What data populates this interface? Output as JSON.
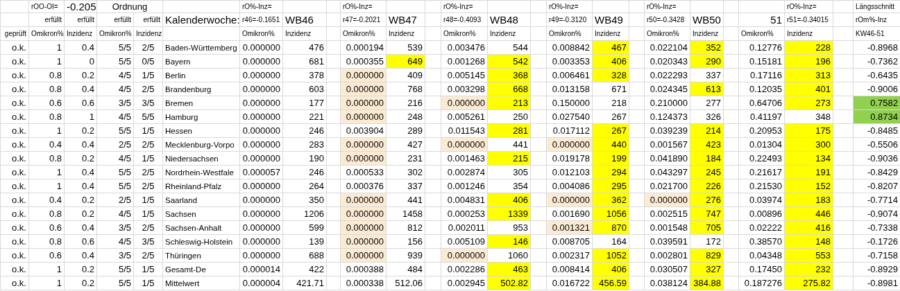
{
  "header": {
    "corr_label": "rOO-OI=",
    "corr_value": "-0.205",
    "order_label": "Ordnung",
    "fulfilled": [
      "erfüllt",
      "erfüllt",
      "erfüllt",
      "erfüllt"
    ],
    "week_label": "Kalenderwoche:",
    "columns": [
      "geprüft",
      "Omikron%",
      "Inzidenz",
      "Omikron%",
      "Inzidenz"
    ]
  },
  "weeks": [
    {
      "kind": "standard",
      "corr_label": "rO%-Inz=",
      "corr": "r46=-0.1651",
      "name": "WB46",
      "columns": [
        "Omikron%",
        "Inzidenz"
      ]
    },
    {
      "kind": "standard",
      "corr_label": "rO%-Inz=",
      "corr": "r47=-0.2021",
      "name": "WB47",
      "columns": [
        "Omikron%",
        "Inzidenz"
      ]
    },
    {
      "kind": "standard",
      "corr_label": "rO%-Inz=",
      "corr": "r48=-0.4093",
      "name": "WB48",
      "columns": [
        "Omikron%",
        "Inzidenz"
      ]
    },
    {
      "kind": "standard",
      "corr_label": "rO%-Inz=",
      "corr": "r49=-0.3120",
      "name": "WB49",
      "columns": [
        "Omikron%",
        "Inzidenz"
      ]
    },
    {
      "kind": "standard",
      "corr_label": "rO%-Inz=",
      "corr": "r50=-0.3428",
      "name": "WB50",
      "columns": [
        "Omikron%",
        "Inzidenz"
      ]
    },
    {
      "kind": "shifted",
      "corr_label": "rO%-Inz=",
      "corr": "r51=-0.34015",
      "name": "51",
      "columns": [
        "Omikron%",
        "Inzidenz"
      ]
    }
  ],
  "summary": {
    "title": "Längsschnitt",
    "subtitle": "rOm%-Inz",
    "range": "KW46-51"
  },
  "rows": [
    {
      "check": "o.k.",
      "omikron": "1",
      "inzidenz": "0.4",
      "order_omikron": "5/5",
      "order_inzidenz": "2/5",
      "state": "Baden-Württemberg",
      "weeks": [
        {
          "omikron": "0.000000",
          "inzidenz": "476",
          "omikron_low": false,
          "inzidenz_high": false
        },
        {
          "omikron": "0.000194",
          "inzidenz": "539",
          "omikron_low": false,
          "inzidenz_high": false
        },
        {
          "omikron": "0.003476",
          "inzidenz": "544",
          "omikron_low": false,
          "inzidenz_high": false
        },
        {
          "omikron": "0.008842",
          "inzidenz": "467",
          "omikron_low": false,
          "inzidenz_high": true
        },
        {
          "omikron": "0.022104",
          "inzidenz": "352",
          "omikron_low": false,
          "inzidenz_high": true
        },
        {
          "omikron": "0.12776",
          "inzidenz": "228",
          "omikron_low": false,
          "inzidenz_high": true
        }
      ],
      "correlation": "-0.8968",
      "positive": false
    },
    {
      "check": "o.k.",
      "omikron": "1",
      "inzidenz": "0",
      "order_omikron": "5/5",
      "order_inzidenz": "0/5",
      "state": "Bayern",
      "weeks": [
        {
          "omikron": "0.000000",
          "inzidenz": "681",
          "omikron_low": false,
          "inzidenz_high": false
        },
        {
          "omikron": "0.000355",
          "inzidenz": "649",
          "omikron_low": false,
          "inzidenz_high": true
        },
        {
          "omikron": "0.001268",
          "inzidenz": "542",
          "omikron_low": false,
          "inzidenz_high": true
        },
        {
          "omikron": "0.003353",
          "inzidenz": "406",
          "omikron_low": false,
          "inzidenz_high": true
        },
        {
          "omikron": "0.020343",
          "inzidenz": "290",
          "omikron_low": false,
          "inzidenz_high": true
        },
        {
          "omikron": "0.15181",
          "inzidenz": "196",
          "omikron_low": false,
          "inzidenz_high": true
        }
      ],
      "correlation": "-0.7362",
      "positive": false
    },
    {
      "check": "o.k.",
      "omikron": "0.8",
      "inzidenz": "0.2",
      "order_omikron": "4/5",
      "order_inzidenz": "1/5",
      "state": "Berlin",
      "weeks": [
        {
          "omikron": "0.000000",
          "inzidenz": "378",
          "omikron_low": false,
          "inzidenz_high": false
        },
        {
          "omikron": "0.000000",
          "inzidenz": "409",
          "omikron_low": true,
          "inzidenz_high": false
        },
        {
          "omikron": "0.005145",
          "inzidenz": "368",
          "omikron_low": false,
          "inzidenz_high": true
        },
        {
          "omikron": "0.006461",
          "inzidenz": "328",
          "omikron_low": false,
          "inzidenz_high": true
        },
        {
          "omikron": "0.022293",
          "inzidenz": "337",
          "omikron_low": false,
          "inzidenz_high": false
        },
        {
          "omikron": "0.17116",
          "inzidenz": "313",
          "omikron_low": false,
          "inzidenz_high": true
        }
      ],
      "correlation": "-0.6435",
      "positive": false
    },
    {
      "check": "o.k.",
      "omikron": "0.8",
      "inzidenz": "0.4",
      "order_omikron": "4/5",
      "order_inzidenz": "2/5",
      "state": "Brandenburg",
      "weeks": [
        {
          "omikron": "0.000000",
          "inzidenz": "603",
          "omikron_low": false,
          "inzidenz_high": false
        },
        {
          "omikron": "0.000000",
          "inzidenz": "768",
          "omikron_low": true,
          "inzidenz_high": false
        },
        {
          "omikron": "0.003298",
          "inzidenz": "668",
          "omikron_low": false,
          "inzidenz_high": true
        },
        {
          "omikron": "0.013158",
          "inzidenz": "671",
          "omikron_low": false,
          "inzidenz_high": false
        },
        {
          "omikron": "0.024345",
          "inzidenz": "613",
          "omikron_low": false,
          "inzidenz_high": true
        },
        {
          "omikron": "0.12035",
          "inzidenz": "401",
          "omikron_low": false,
          "inzidenz_high": true
        }
      ],
      "correlation": "-0.9006",
      "positive": false
    },
    {
      "check": "o.k.",
      "omikron": "0.6",
      "inzidenz": "0.6",
      "order_omikron": "3/5",
      "order_inzidenz": "3/5",
      "state": "Bremen",
      "weeks": [
        {
          "omikron": "0.000000",
          "inzidenz": "177",
          "omikron_low": false,
          "inzidenz_high": false
        },
        {
          "omikron": "0.000000",
          "inzidenz": "216",
          "omikron_low": true,
          "inzidenz_high": false
        },
        {
          "omikron": "0.000000",
          "inzidenz": "213",
          "omikron_low": true,
          "inzidenz_high": true
        },
        {
          "omikron": "0.150000",
          "inzidenz": "218",
          "omikron_low": false,
          "inzidenz_high": false
        },
        {
          "omikron": "0.210000",
          "inzidenz": "277",
          "omikron_low": false,
          "inzidenz_high": false
        },
        {
          "omikron": "0.64706",
          "inzidenz": "273",
          "omikron_low": false,
          "inzidenz_high": true
        }
      ],
      "correlation": "0.7582",
      "positive": true
    },
    {
      "check": "o.k.",
      "omikron": "0.8",
      "inzidenz": "1",
      "order_omikron": "4/5",
      "order_inzidenz": "5/5",
      "state": "Hamburg",
      "weeks": [
        {
          "omikron": "0.000000",
          "inzidenz": "221",
          "omikron_low": false,
          "inzidenz_high": false
        },
        {
          "omikron": "0.000000",
          "inzidenz": "248",
          "omikron_low": true,
          "inzidenz_high": false
        },
        {
          "omikron": "0.005261",
          "inzidenz": "250",
          "omikron_low": false,
          "inzidenz_high": false
        },
        {
          "omikron": "0.027540",
          "inzidenz": "267",
          "omikron_low": false,
          "inzidenz_high": false
        },
        {
          "omikron": "0.124373",
          "inzidenz": "326",
          "omikron_low": false,
          "inzidenz_high": false
        },
        {
          "omikron": "0.41197",
          "inzidenz": "348",
          "omikron_low": false,
          "inzidenz_high": false
        }
      ],
      "correlation": "0.8734",
      "positive": true
    },
    {
      "check": "o.k.",
      "omikron": "1",
      "inzidenz": "0.2",
      "order_omikron": "5/5",
      "order_inzidenz": "1/5",
      "state": "Hessen",
      "weeks": [
        {
          "omikron": "0.000000",
          "inzidenz": "246",
          "omikron_low": false,
          "inzidenz_high": false
        },
        {
          "omikron": "0.003904",
          "inzidenz": "289",
          "omikron_low": false,
          "inzidenz_high": false
        },
        {
          "omikron": "0.011543",
          "inzidenz": "281",
          "omikron_low": false,
          "inzidenz_high": true
        },
        {
          "omikron": "0.017112",
          "inzidenz": "267",
          "omikron_low": false,
          "inzidenz_high": true
        },
        {
          "omikron": "0.039239",
          "inzidenz": "214",
          "omikron_low": false,
          "inzidenz_high": true
        },
        {
          "omikron": "0.20953",
          "inzidenz": "175",
          "omikron_low": false,
          "inzidenz_high": true
        }
      ],
      "correlation": "-0.8485",
      "positive": false
    },
    {
      "check": "o.k.",
      "omikron": "0.4",
      "inzidenz": "0.4",
      "order_omikron": "2/5",
      "order_inzidenz": "2/5",
      "state": "Mecklenburg-Vorpo",
      "weeks": [
        {
          "omikron": "0.000000",
          "inzidenz": "283",
          "omikron_low": false,
          "inzidenz_high": false
        },
        {
          "omikron": "0.000000",
          "inzidenz": "427",
          "omikron_low": true,
          "inzidenz_high": false
        },
        {
          "omikron": "0.000000",
          "inzidenz": "441",
          "omikron_low": true,
          "inzidenz_high": false
        },
        {
          "omikron": "0.000000",
          "inzidenz": "440",
          "omikron_low": true,
          "inzidenz_high": true
        },
        {
          "omikron": "0.001567",
          "inzidenz": "423",
          "omikron_low": false,
          "inzidenz_high": true
        },
        {
          "omikron": "0.01304",
          "inzidenz": "300",
          "omikron_low": false,
          "inzidenz_high": true
        }
      ],
      "correlation": "-0.5506",
      "positive": false
    },
    {
      "check": "o.k.",
      "omikron": "0.8",
      "inzidenz": "0.2",
      "order_omikron": "4/5",
      "order_inzidenz": "1/5",
      "state": "Niedersachsen",
      "weeks": [
        {
          "omikron": "0.000000",
          "inzidenz": "190",
          "omikron_low": false,
          "inzidenz_high": false
        },
        {
          "omikron": "0.000000",
          "inzidenz": "231",
          "omikron_low": true,
          "inzidenz_high": false
        },
        {
          "omikron": "0.001463",
          "inzidenz": "215",
          "omikron_low": false,
          "inzidenz_high": true
        },
        {
          "omikron": "0.019178",
          "inzidenz": "199",
          "omikron_low": false,
          "inzidenz_high": true
        },
        {
          "omikron": "0.041890",
          "inzidenz": "184",
          "omikron_low": false,
          "inzidenz_high": true
        },
        {
          "omikron": "0.22493",
          "inzidenz": "134",
          "omikron_low": false,
          "inzidenz_high": true
        }
      ],
      "correlation": "-0.9036",
      "positive": false
    },
    {
      "check": "o.k.",
      "omikron": "1",
      "inzidenz": "0.4",
      "order_omikron": "5/5",
      "order_inzidenz": "2/5",
      "state": "Nordrhein-Westfale",
      "weeks": [
        {
          "omikron": "0.000057",
          "inzidenz": "246",
          "omikron_low": false,
          "inzidenz_high": false
        },
        {
          "omikron": "0.000533",
          "inzidenz": "302",
          "omikron_low": false,
          "inzidenz_high": false
        },
        {
          "omikron": "0.002874",
          "inzidenz": "305",
          "omikron_low": false,
          "inzidenz_high": false
        },
        {
          "omikron": "0.012103",
          "inzidenz": "294",
          "omikron_low": false,
          "inzidenz_high": true
        },
        {
          "omikron": "0.043297",
          "inzidenz": "245",
          "omikron_low": false,
          "inzidenz_high": true
        },
        {
          "omikron": "0.21617",
          "inzidenz": "191",
          "omikron_low": false,
          "inzidenz_high": true
        }
      ],
      "correlation": "-0.8429",
      "positive": false
    },
    {
      "check": "o.k.",
      "omikron": "1",
      "inzidenz": "0.4",
      "order_omikron": "5/5",
      "order_inzidenz": "2/5",
      "state": "Rheinland-Pfalz",
      "weeks": [
        {
          "omikron": "0.000000",
          "inzidenz": "264",
          "omikron_low": false,
          "inzidenz_high": false
        },
        {
          "omikron": "0.000376",
          "inzidenz": "337",
          "omikron_low": false,
          "inzidenz_high": false
        },
        {
          "omikron": "0.001246",
          "inzidenz": "354",
          "omikron_low": false,
          "inzidenz_high": false
        },
        {
          "omikron": "0.004086",
          "inzidenz": "295",
          "omikron_low": false,
          "inzidenz_high": true
        },
        {
          "omikron": "0.021700",
          "inzidenz": "226",
          "omikron_low": false,
          "inzidenz_high": true
        },
        {
          "omikron": "0.21530",
          "inzidenz": "152",
          "omikron_low": false,
          "inzidenz_high": true
        }
      ],
      "correlation": "-0.8207",
      "positive": false
    },
    {
      "check": "o.k.",
      "omikron": "0.4",
      "inzidenz": "0.2",
      "order_omikron": "2/5",
      "order_inzidenz": "1/5",
      "state": "Saarland",
      "weeks": [
        {
          "omikron": "0.000000",
          "inzidenz": "350",
          "omikron_low": false,
          "inzidenz_high": false
        },
        {
          "omikron": "0.000000",
          "inzidenz": "441",
          "omikron_low": true,
          "inzidenz_high": false
        },
        {
          "omikron": "0.004831",
          "inzidenz": "406",
          "omikron_low": false,
          "inzidenz_high": true
        },
        {
          "omikron": "0.000000",
          "inzidenz": "362",
          "omikron_low": true,
          "inzidenz_high": true
        },
        {
          "omikron": "0.000000",
          "inzidenz": "276",
          "omikron_low": true,
          "inzidenz_high": true
        },
        {
          "omikron": "0.03974",
          "inzidenz": "183",
          "omikron_low": false,
          "inzidenz_high": true
        }
      ],
      "correlation": "-0.7714",
      "positive": false
    },
    {
      "check": "o.k.",
      "omikron": "0.8",
      "inzidenz": "0.2",
      "order_omikron": "4/5",
      "order_inzidenz": "1/5",
      "state": "Sachsen",
      "weeks": [
        {
          "omikron": "0.000000",
          "inzidenz": "1206",
          "omikron_low": false,
          "inzidenz_high": false
        },
        {
          "omikron": "0.000000",
          "inzidenz": "1458",
          "omikron_low": true,
          "inzidenz_high": false
        },
        {
          "omikron": "0.000253",
          "inzidenz": "1339",
          "omikron_low": false,
          "inzidenz_high": true
        },
        {
          "omikron": "0.001690",
          "inzidenz": "1056",
          "omikron_low": false,
          "inzidenz_high": true
        },
        {
          "omikron": "0.002515",
          "inzidenz": "747",
          "omikron_low": false,
          "inzidenz_high": true
        },
        {
          "omikron": "0.00896",
          "inzidenz": "446",
          "omikron_low": false,
          "inzidenz_high": true
        }
      ],
      "correlation": "-0.9074",
      "positive": false
    },
    {
      "check": "o.k.",
      "omikron": "0.6",
      "inzidenz": "0.4",
      "order_omikron": "3/5",
      "order_inzidenz": "2/5",
      "state": "Sachsen-Anhalt",
      "weeks": [
        {
          "omikron": "0.000000",
          "inzidenz": "599",
          "omikron_low": false,
          "inzidenz_high": false
        },
        {
          "omikron": "0.000000",
          "inzidenz": "812",
          "omikron_low": true,
          "inzidenz_high": false
        },
        {
          "omikron": "0.002011",
          "inzidenz": "953",
          "omikron_low": false,
          "inzidenz_high": false
        },
        {
          "omikron": "0.001321",
          "inzidenz": "870",
          "omikron_low": true,
          "inzidenz_high": true
        },
        {
          "omikron": "0.001548",
          "inzidenz": "705",
          "omikron_low": false,
          "inzidenz_high": true
        },
        {
          "omikron": "0.02222",
          "inzidenz": "416",
          "omikron_low": false,
          "inzidenz_high": true
        }
      ],
      "correlation": "-0.7338",
      "positive": false
    },
    {
      "check": "o.k.",
      "omikron": "0.8",
      "inzidenz": "0.6",
      "order_omikron": "4/5",
      "order_inzidenz": "3/5",
      "state": "Schleswig-Holstein",
      "weeks": [
        {
          "omikron": "0.000000",
          "inzidenz": "139",
          "omikron_low": false,
          "inzidenz_high": false
        },
        {
          "omikron": "0.000000",
          "inzidenz": "156",
          "omikron_low": true,
          "inzidenz_high": false
        },
        {
          "omikron": "0.005109",
          "inzidenz": "146",
          "omikron_low": false,
          "inzidenz_high": true
        },
        {
          "omikron": "0.008705",
          "inzidenz": "164",
          "omikron_low": false,
          "inzidenz_high": false
        },
        {
          "omikron": "0.039591",
          "inzidenz": "172",
          "omikron_low": false,
          "inzidenz_high": false
        },
        {
          "omikron": "0.38570",
          "inzidenz": "148",
          "omikron_low": false,
          "inzidenz_high": true
        }
      ],
      "correlation": "-0.1726",
      "positive": false
    },
    {
      "check": "o.k.",
      "omikron": "0.6",
      "inzidenz": "0.4",
      "order_omikron": "3/5",
      "order_inzidenz": "2/5",
      "state": "Thüringen",
      "weeks": [
        {
          "omikron": "0.000000",
          "inzidenz": "688",
          "omikron_low": false,
          "inzidenz_high": false
        },
        {
          "omikron": "0.000000",
          "inzidenz": "939",
          "omikron_low": true,
          "inzidenz_high": false
        },
        {
          "omikron": "0.000000",
          "inzidenz": "1060",
          "omikron_low": true,
          "inzidenz_high": false
        },
        {
          "omikron": "0.002317",
          "inzidenz": "1052",
          "omikron_low": false,
          "inzidenz_high": true
        },
        {
          "omikron": "0.002801",
          "inzidenz": "829",
          "omikron_low": false,
          "inzidenz_high": true
        },
        {
          "omikron": "0.04348",
          "inzidenz": "553",
          "omikron_low": false,
          "inzidenz_high": true
        }
      ],
      "correlation": "-0.7158",
      "positive": false
    },
    {
      "check": "o.k.",
      "omikron": "1",
      "inzidenz": "0.2",
      "order_omikron": "5/5",
      "order_inzidenz": "1/5",
      "state": "Gesamt-De",
      "weeks": [
        {
          "omikron": "0.000014",
          "inzidenz": "422",
          "omikron_low": false,
          "inzidenz_high": false
        },
        {
          "omikron": "0.000388",
          "inzidenz": "484",
          "omikron_low": false,
          "inzidenz_high": false
        },
        {
          "omikron": "0.002286",
          "inzidenz": "463",
          "omikron_low": false,
          "inzidenz_high": true
        },
        {
          "omikron": "0.008414",
          "inzidenz": "406",
          "omikron_low": false,
          "inzidenz_high": true
        },
        {
          "omikron": "0.030507",
          "inzidenz": "327",
          "omikron_low": false,
          "inzidenz_high": true
        },
        {
          "omikron": "0.17450",
          "inzidenz": "232",
          "omikron_low": false,
          "inzidenz_high": true
        }
      ],
      "correlation": "-0.8929",
      "positive": false
    },
    {
      "check": "o.k.",
      "omikron": "1",
      "inzidenz": "0.2",
      "order_omikron": "5/5",
      "order_inzidenz": "1/5",
      "state": "Mittelwert",
      "weeks": [
        {
          "omikron": "0.000004",
          "inzidenz": "421.71",
          "omikron_low": false,
          "inzidenz_high": false
        },
        {
          "omikron": "0.000338",
          "inzidenz": "512.06",
          "omikron_low": false,
          "inzidenz_high": false
        },
        {
          "omikron": "0.002945",
          "inzidenz": "502.82",
          "omikron_low": false,
          "inzidenz_high": true
        },
        {
          "omikron": "0.016722",
          "inzidenz": "456.59",
          "omikron_low": false,
          "inzidenz_high": true
        },
        {
          "omikron": "0.038124",
          "inzidenz": "384.88",
          "omikron_low": false,
          "inzidenz_high": true
        },
        {
          "omikron": "0.187276",
          "inzidenz": "275.82",
          "omikron_low": false,
          "inzidenz_high": true
        }
      ],
      "correlation": "-0.8981",
      "positive": false
    }
  ]
}
